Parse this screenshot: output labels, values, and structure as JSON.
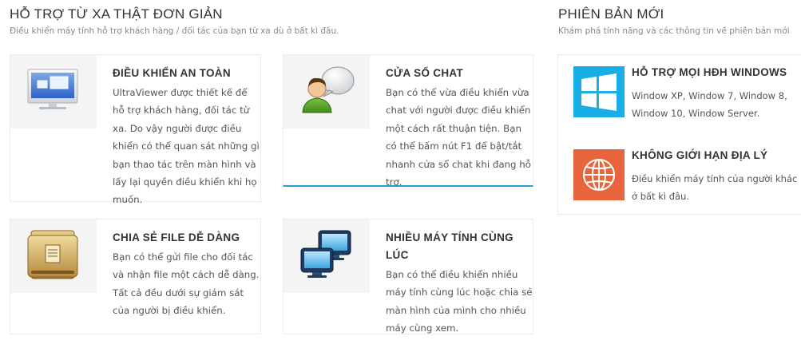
{
  "left_section": {
    "title": "HỖ TRỢ TỪ XA THẬT ĐƠN GIẢN",
    "subtitle": "Điều khiển máy tính hỗ trợ khách hàng / đối tác của bạn từ xa dù ở bất kì đâu."
  },
  "right_section": {
    "title": "PHIÊN BẢN MỚI",
    "subtitle": "Khám phá tính năng và các thông tin về phiên bản mới"
  },
  "features": [
    {
      "icon": "monitor-icon",
      "title": "ĐIỀU KHIỂN AN TOÀN",
      "body": "UltraViewer được thiết kế để hỗ trợ khách hàng, đối tác từ xa. Do vậy người được điều khiển có thể quan sát những gì bạn thao tác trên màn hình và lấy lại quyền điều khiển khi họ muốn."
    },
    {
      "icon": "chat-user-icon",
      "title": "CỬA SỔ CHAT",
      "body": "Bạn có thể vừa điều khiển vừa chat với người được điều khiển một cách rất thuận tiện. Bạn có thể bấm nút F1 để bật/tắt nhanh cửa sổ chat khi đang hỗ trợ."
    },
    {
      "icon": "folder-icon",
      "title": "CHIA SẺ FILE DỄ DÀNG",
      "body": "Bạn có thể gửi file cho đối tác và nhận file một cách dễ dàng. Tất cả đều dưới sự giám sát của người bị điều khiển."
    },
    {
      "icon": "multi-monitor-icon",
      "title": "NHIỀU MÁY TÍNH CÙNG LÚC",
      "body": "Bạn có thể điều khiển nhiều máy tính cùng lúc hoặc chia sẻ màn hình của mình cho nhiều máy cùng xem."
    }
  ],
  "new_version": [
    {
      "icon": "windows-icon",
      "color": "#19aee6",
      "title": "HỖ TRỢ MỌI HĐH WINDOWS",
      "body": "Window XP, Window 7, Window 8, Window 10, Window Server."
    },
    {
      "icon": "globe-icon",
      "color": "#e8643c",
      "title": "KHÔNG GIỚI HẠN ĐỊA LÝ",
      "body": "Điều khiển máy tính của người khác ở bất kì đâu."
    }
  ],
  "accent_color": "#2a9fd6"
}
